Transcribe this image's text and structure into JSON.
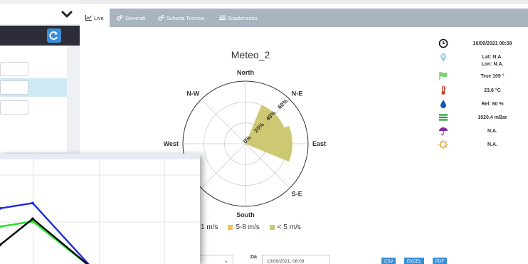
{
  "tabs": [
    {
      "label": "Live",
      "icon": "line-chart-icon",
      "active": true
    },
    {
      "label": "Generali",
      "icon": "gears-icon",
      "active": false
    },
    {
      "label": "Scheda Tecnica",
      "icon": "gears-icon",
      "active": false
    },
    {
      "label": "Scadenzario",
      "icon": "list-icon",
      "active": false
    }
  ],
  "chart_data": [
    {
      "type": "wind-rose",
      "title": "Meteo_2",
      "directions": [
        "North",
        "N-E",
        "East",
        "S-E",
        "South",
        "West",
        "N-W"
      ],
      "radial_ticks": [
        "0%",
        "20%",
        "40%",
        "60%"
      ],
      "radial_max": 60,
      "series": [
        {
          "name": "< 5 m/s",
          "color": "#cdc872",
          "values": {
            "N-E": 40,
            "East": 45
          }
        },
        {
          "name": "5-8 m/s",
          "color": "#f0c35a",
          "values": {}
        },
        {
          "name": "1 m/s",
          "color": "#9a96d8",
          "values": {}
        }
      ],
      "legend_visible": [
        "1 m/s",
        "5-8 m/s",
        "< 5 m/s"
      ]
    },
    {
      "type": "line",
      "title": "",
      "series": [
        {
          "color": "#1f2bd8",
          "values": [
            0.48,
            0.52,
            0.02
          ]
        },
        {
          "color": "#23e523",
          "values": [
            0.34,
            0.38,
            0.02
          ]
        },
        {
          "color": "#000000",
          "values": [
            0.2,
            0.4,
            0.02
          ]
        }
      ]
    }
  ],
  "info": {
    "datetime": "10/09/2021 08:58",
    "lat": "Lat: N.A.",
    "lon": "Lon: N.A.",
    "direction": "True 109 °",
    "temperature": "23.6 °C",
    "humidity": "Rel: 60 %",
    "pressure": "1020.4 mBar",
    "rain": "N.A.",
    "sun": "N.A."
  },
  "form": {
    "da_label": "Da",
    "date_value": "10/09/2021, 08:09",
    "buttons": [
      "CSV",
      "EXCEL",
      "PDF"
    ]
  },
  "colors": {
    "accent": "#3a8fd8",
    "tabbar": "#a8b4bf",
    "green": "#27a33a",
    "flag_green": "#7ad37a",
    "red": "#d03a2b",
    "umbrella": "#8a2a9e",
    "sun": "#f2a412"
  }
}
